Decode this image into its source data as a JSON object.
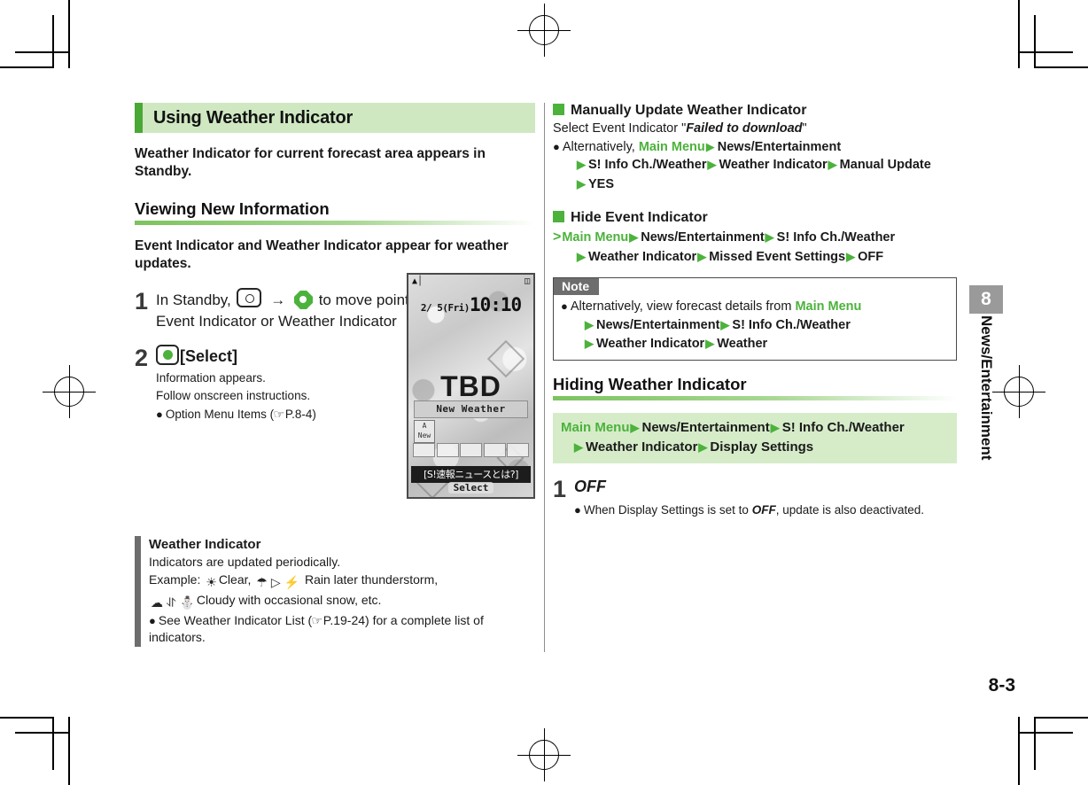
{
  "page": {
    "number": "8-3",
    "chapter_number": "8",
    "chapter_title": "News/Entertainment"
  },
  "left_column": {
    "section_title": "Using Weather Indicator",
    "lede": "Weather Indicator for current forecast area appears in Standby.",
    "subsection_title": "Viewing New Information",
    "subhead": "Event Indicator and Weather Indicator appear for weather updates.",
    "steps": [
      {
        "num": "1",
        "text_a": "In Standby,",
        "text_b": "to move pointer",
        "text_c": "Select Event Indicator or Weather Indicator",
        "key_center_icon": "center-key-icon",
        "key_nav_icon": "navigation-key-icon",
        "arrow": "→"
      },
      {
        "num": "2",
        "key_select_icon": "select-key-icon",
        "label": "[Select]",
        "sub_lines": [
          "Information appears.",
          "Follow onscreen instructions."
        ],
        "bullet_text": "Option Menu Items (",
        "bullet_ref": "P.8-4",
        "bullet_tail": ")"
      }
    ],
    "grey_note": {
      "title": "Weather Indicator",
      "line1": "Indicators are updated periodically.",
      "line2_prefix": "Example:",
      "line2_clear": "Clear,",
      "line2_rain": "Rain later thunderstorm,",
      "line3_cloudy": "Cloudy with occasional snow, etc.",
      "bullet_prefix": "See Weather Indicator List (",
      "bullet_ref": "P.19-24",
      "bullet_tail": ") for a complete list of indicators."
    }
  },
  "phone_screen": {
    "signal_icon": "signal-strength-icon",
    "battery_icon": "battery-icon",
    "date": "2/ 5(Fri)",
    "clock": "10:10",
    "wallpaper_text": "TBD",
    "banner": "New Weather",
    "new_badge_line1": "A",
    "new_badge_line2": "New",
    "ticker": "[S!速報ニュースとは?]",
    "softkey": "Select"
  },
  "right_column": {
    "block1": {
      "heading": "Manually Update Weather Indicator",
      "line1_prefix": "Select Event Indicator \"",
      "line1_emph": "Failed to download",
      "line1_suffix": "\"",
      "bullet_prefix": "Alternatively,",
      "path": [
        "Main Menu",
        "News/Entertainment",
        "S! Info Ch./Weather",
        "Weather Indicator",
        "Manual Update",
        "YES"
      ]
    },
    "block2": {
      "heading": "Hide Event Indicator",
      "path": [
        "Main Menu",
        "News/Entertainment",
        "S! Info Ch./Weather",
        "Weather Indicator",
        "Missed Event Settings",
        "OFF"
      ]
    },
    "note": {
      "tab_label": "Note",
      "bullet_prefix": "Alternatively, view forecast details from",
      "path": [
        "Main Menu",
        "News/Entertainment",
        "S! Info Ch./Weather",
        "Weather Indicator",
        "Weather"
      ]
    },
    "section2": {
      "title": "Hiding Weather Indicator",
      "command_path": [
        "Main Menu",
        "News/Entertainment",
        "S! Info Ch./Weather",
        "Weather Indicator",
        "Display Settings"
      ],
      "step": {
        "num": "1",
        "label": "OFF",
        "bullet_a": "When Display Settings is set to ",
        "bullet_emph": "OFF",
        "bullet_b": ", update is also deactivated."
      }
    }
  },
  "colors": {
    "accent_green": "#4cb23c",
    "header_bg": "#cfe8c2",
    "header_accent": "#4aa836",
    "command_bar_bg": "#d6ecc9",
    "grey_bar": "#6d6d6d",
    "tab_grey": "#9a9a9a"
  }
}
